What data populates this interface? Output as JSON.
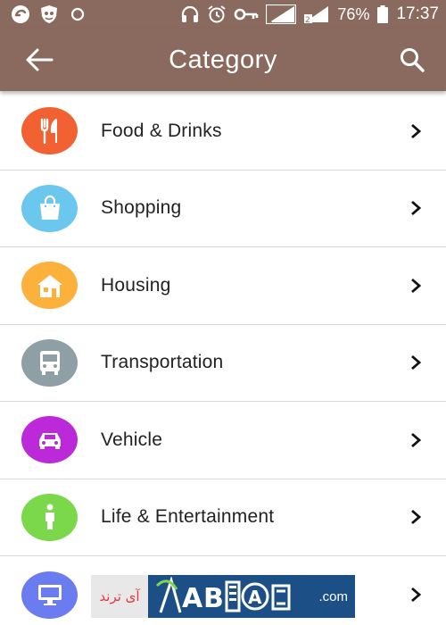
{
  "status_bar": {
    "battery": "76%",
    "time": "17:37",
    "sim1": "1",
    "sim2": "2"
  },
  "app_bar": {
    "title": "Category",
    "back_icon": "arrow-left-icon",
    "search_icon": "search-icon"
  },
  "categories": [
    {
      "label": "Food & Drinks",
      "color": "#f26132",
      "icon": "fork-knife-icon"
    },
    {
      "label": "Shopping",
      "color": "#6cc7ef",
      "icon": "shopping-bag-icon"
    },
    {
      "label": "Housing",
      "color": "#fbb13c",
      "icon": "house-icon"
    },
    {
      "label": "Transportation",
      "color": "#8e9fa5",
      "icon": "bus-icon"
    },
    {
      "label": "Vehicle",
      "color": "#bb29d8",
      "icon": "car-icon"
    },
    {
      "label": "Life & Entertainment",
      "color": "#7ad84a",
      "icon": "person-icon"
    },
    {
      "label": "",
      "color": "#6b7bf0",
      "icon": "monitor-icon"
    }
  ],
  "watermark": {
    "persian_text": "آی ترند",
    "domain_suffix": ".com"
  }
}
